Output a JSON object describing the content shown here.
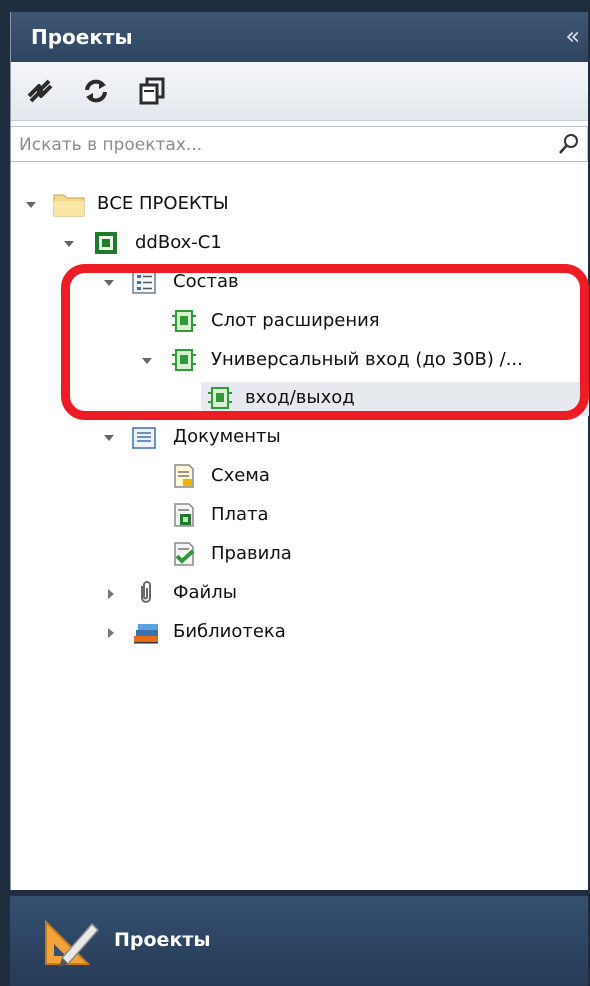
{
  "panel": {
    "title": "Проекты",
    "collapse_glyph": "«"
  },
  "toolbar": {
    "buttons": [
      "sync-arrows-icon",
      "refresh-icon",
      "copy-windows-icon"
    ]
  },
  "search": {
    "placeholder": "Искать в проектах..."
  },
  "tree": {
    "items": [
      {
        "label": "ВСЕ ПРОЕКТЫ",
        "icon": "folder-icon",
        "expanded": true
      },
      {
        "label": "ddBox-C1",
        "icon": "board-chip-icon",
        "expanded": true
      },
      {
        "label": "Состав",
        "icon": "list-icon",
        "expanded": true
      },
      {
        "label": "Слот расширения",
        "icon": "module-icon"
      },
      {
        "label": "Универсальный вход (до 30В) /...",
        "icon": "module-icon",
        "expanded": true
      },
      {
        "label": "вход/выход",
        "icon": "module-icon",
        "selected": true
      },
      {
        "label": "Документы",
        "icon": "documents-icon",
        "expanded": true
      },
      {
        "label": "Схема",
        "icon": "schematic-doc-icon"
      },
      {
        "label": "Плата",
        "icon": "pcb-doc-icon"
      },
      {
        "label": "Правила",
        "icon": "rules-doc-icon"
      },
      {
        "label": "Файлы",
        "icon": "paperclip-icon",
        "expanded": false
      },
      {
        "label": "Библиотека",
        "icon": "library-icon",
        "expanded": false
      }
    ]
  },
  "bottom_nav": {
    "label": "Проекты",
    "icon": "drafting-tools-icon"
  },
  "colors": {
    "header": "#2e4561",
    "highlight": "#ee1c25",
    "module_green": "#2f9a3a"
  }
}
